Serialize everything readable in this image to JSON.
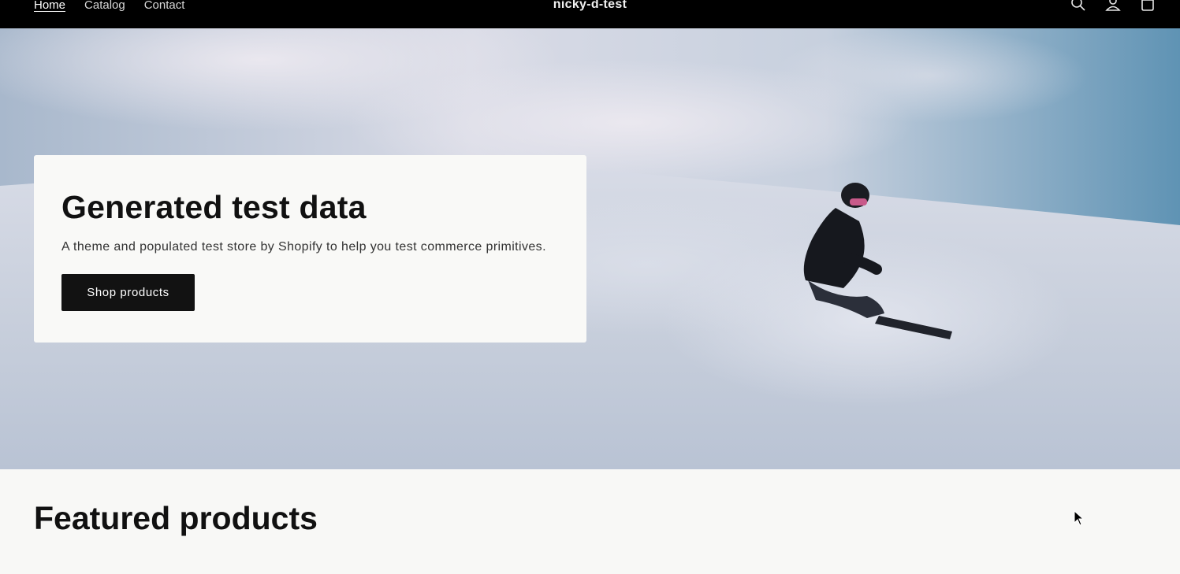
{
  "header": {
    "store_name": "nicky-d-test",
    "nav": [
      {
        "label": "Home",
        "active": true
      },
      {
        "label": "Catalog",
        "active": false
      },
      {
        "label": "Contact",
        "active": false
      }
    ],
    "icons": [
      "search-icon",
      "account-icon",
      "cart-icon"
    ]
  },
  "hero": {
    "title": "Generated test data",
    "text": "A theme and populated test store by Shopify to help you test commerce primitives.",
    "button_label": "Shop products",
    "image": "snowboarder-on-slope"
  },
  "featured": {
    "title": "Featured products"
  },
  "colors": {
    "header_bg": "#000000",
    "button_bg": "#121212",
    "card_bg": "#f9f9f7",
    "page_bg": "#f8f8f6"
  }
}
